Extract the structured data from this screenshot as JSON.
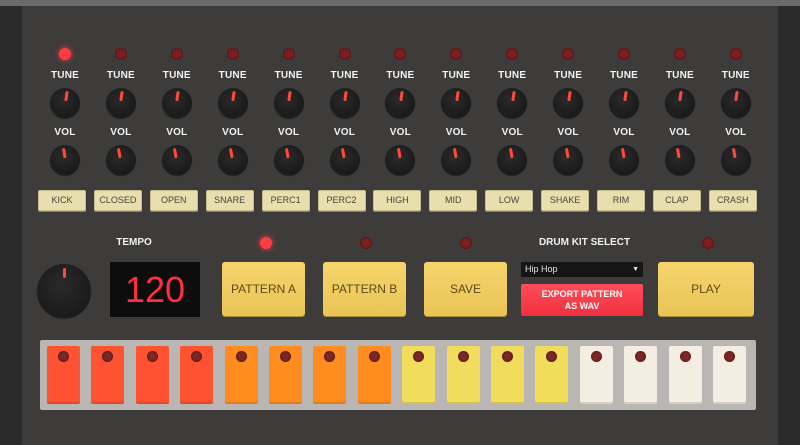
{
  "labels": {
    "tune": "TUNE",
    "vol": "VOL"
  },
  "channels": [
    {
      "sound": "KICK",
      "active": true
    },
    {
      "sound": "CLOSED",
      "active": false
    },
    {
      "sound": "OPEN",
      "active": false
    },
    {
      "sound": "SNARE",
      "active": false
    },
    {
      "sound": "PERC1",
      "active": false
    },
    {
      "sound": "PERC2",
      "active": false
    },
    {
      "sound": "HIGH",
      "active": false
    },
    {
      "sound": "MID",
      "active": false
    },
    {
      "sound": "LOW",
      "active": false
    },
    {
      "sound": "SHAKE",
      "active": false
    },
    {
      "sound": "RIM",
      "active": false
    },
    {
      "sound": "CLAP",
      "active": false
    },
    {
      "sound": "CRASH",
      "active": false
    }
  ],
  "tempo": {
    "label": "TEMPO",
    "value": "120"
  },
  "buttons": {
    "pattern_a": "PATTERN A",
    "pattern_b": "PATTERN B",
    "save": "SAVE",
    "play": "PLAY",
    "export_line1": "EXPORT PATTERN",
    "export_line2": "AS WAV"
  },
  "indicators": {
    "pattern_a": true,
    "pattern_b": false,
    "save": false,
    "play": false
  },
  "drum_kit": {
    "label": "DRUM KIT SELECT",
    "selected": "Hip Hop"
  },
  "colors": {
    "led_on": "#ff3b46",
    "led_off": "#7b1f1f",
    "step_red": "#ff5230",
    "step_orange": "#ff8c1f",
    "step_yellow": "#f1dc5c",
    "step_white": "#f3ede2"
  },
  "steps": [
    "red",
    "red",
    "red",
    "red",
    "orange",
    "orange",
    "orange",
    "orange",
    "yellow",
    "yellow",
    "yellow",
    "yellow",
    "white",
    "white",
    "white",
    "white"
  ]
}
